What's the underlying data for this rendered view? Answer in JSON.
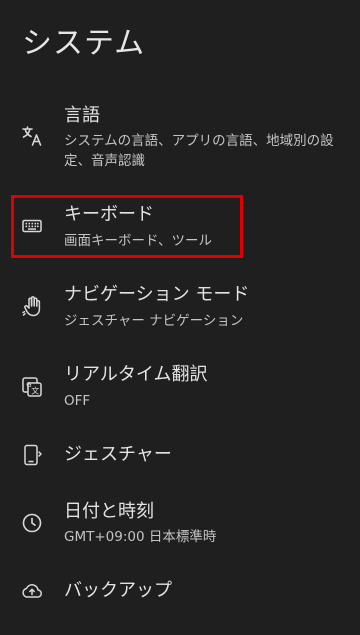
{
  "header": {
    "title": "システム"
  },
  "items": [
    {
      "title": "言語",
      "subtitle": "システムの言語、アプリの言語、地域別の設定、音声認識",
      "icon": "translate-icon"
    },
    {
      "title": "キーボード",
      "subtitle": "画面キーボード、ツール",
      "icon": "keyboard-icon"
    },
    {
      "title": "ナビゲーション モード",
      "subtitle": "ジェスチャー ナビゲーション",
      "icon": "gesture-hand-icon"
    },
    {
      "title": "リアルタイム翻訳",
      "subtitle": "OFF",
      "icon": "live-translate-icon"
    },
    {
      "title": "ジェスチャー",
      "subtitle": "",
      "icon": "phone-gesture-icon"
    },
    {
      "title": "日付と時刻",
      "subtitle": "GMT+09:00 日本標準時",
      "icon": "clock-icon"
    },
    {
      "title": "バックアップ",
      "subtitle": "",
      "icon": "cloud-backup-icon"
    }
  ],
  "colors": {
    "background": "#1f1f1f",
    "highlight": "#e00000",
    "text_primary": "#e3e3e3",
    "text_secondary": "#c4c4c4"
  }
}
